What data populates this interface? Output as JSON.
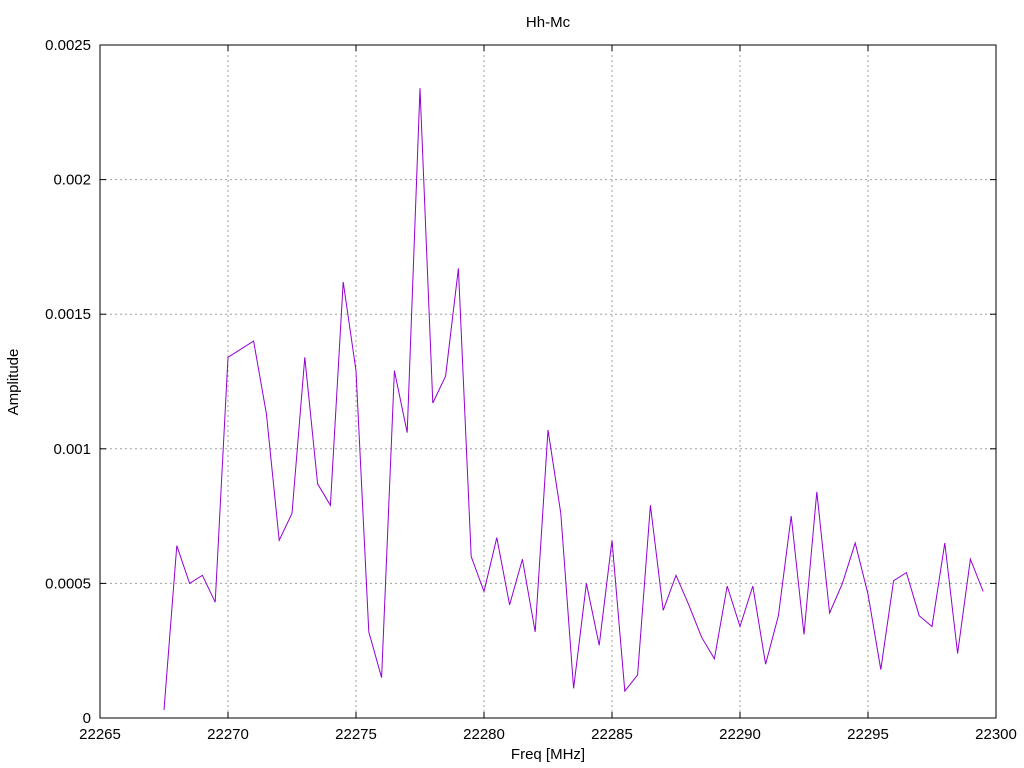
{
  "chart_data": {
    "type": "line",
    "title": "Hh-Mc",
    "xlabel": "Freq [MHz]",
    "ylabel": "Amplitude",
    "xlim": [
      22265,
      22300
    ],
    "ylim": [
      0,
      0.0025
    ],
    "xticks": [
      "22265",
      "22270",
      "22275",
      "22280",
      "22285",
      "22290",
      "22295",
      "22300"
    ],
    "yticks": [
      "0",
      "0.0005",
      "0.001",
      "0.0015",
      "0.002",
      "0.0025"
    ],
    "grid": true,
    "series_color": "#9400d3",
    "series": [
      {
        "x": [
          22267.5,
          22268,
          22268.5,
          22269,
          22269.5,
          22270,
          22270.5,
          22271,
          22271.5,
          22272,
          22272.5,
          22273,
          22273.5,
          22274,
          22274.5,
          22275,
          22275.5,
          22276,
          22276.5,
          22277,
          22277.5,
          22278,
          22278.5,
          22279,
          22279.5,
          22280,
          22280.5,
          22281,
          22281.5,
          22282,
          22282.5,
          22283,
          22283.5,
          22284,
          22284.5,
          22285,
          22285.5,
          22286,
          22286.5,
          22287,
          22287.5,
          22288,
          22288.5,
          22289,
          22289.5,
          22290,
          22290.5,
          22291,
          22291.5,
          22292,
          22292.5,
          22293,
          22293.5,
          22294,
          22294.5,
          22295,
          22295.5,
          22296,
          22296.5,
          22297,
          22297.5,
          22298,
          22298.5,
          22299,
          22299.5
        ],
        "y": [
          3e-05,
          0.00064,
          0.0005,
          0.00053,
          0.00043,
          0.00134,
          0.00137,
          0.0014,
          0.00113,
          0.00066,
          0.00076,
          0.00134,
          0.00087,
          0.00079,
          0.00162,
          0.00129,
          0.00032,
          0.00015,
          0.00129,
          0.00106,
          0.00234,
          0.00117,
          0.00127,
          0.00167,
          0.0006,
          0.00047,
          0.00067,
          0.00042,
          0.00059,
          0.00032,
          0.00107,
          0.00076,
          0.00011,
          0.0005,
          0.00027,
          0.00066,
          0.0001,
          0.00016,
          0.00079,
          0.0004,
          0.00053,
          0.00042,
          0.0003,
          0.00022,
          0.00049,
          0.00034,
          0.00049,
          0.0002,
          0.00038,
          0.00075,
          0.00031,
          0.00084,
          0.00039,
          0.0005,
          0.00065,
          0.00046,
          0.00018,
          0.00051,
          0.00054,
          0.00038,
          0.00034,
          0.00065,
          0.00024,
          0.00059,
          0.00047
        ]
      }
    ]
  }
}
